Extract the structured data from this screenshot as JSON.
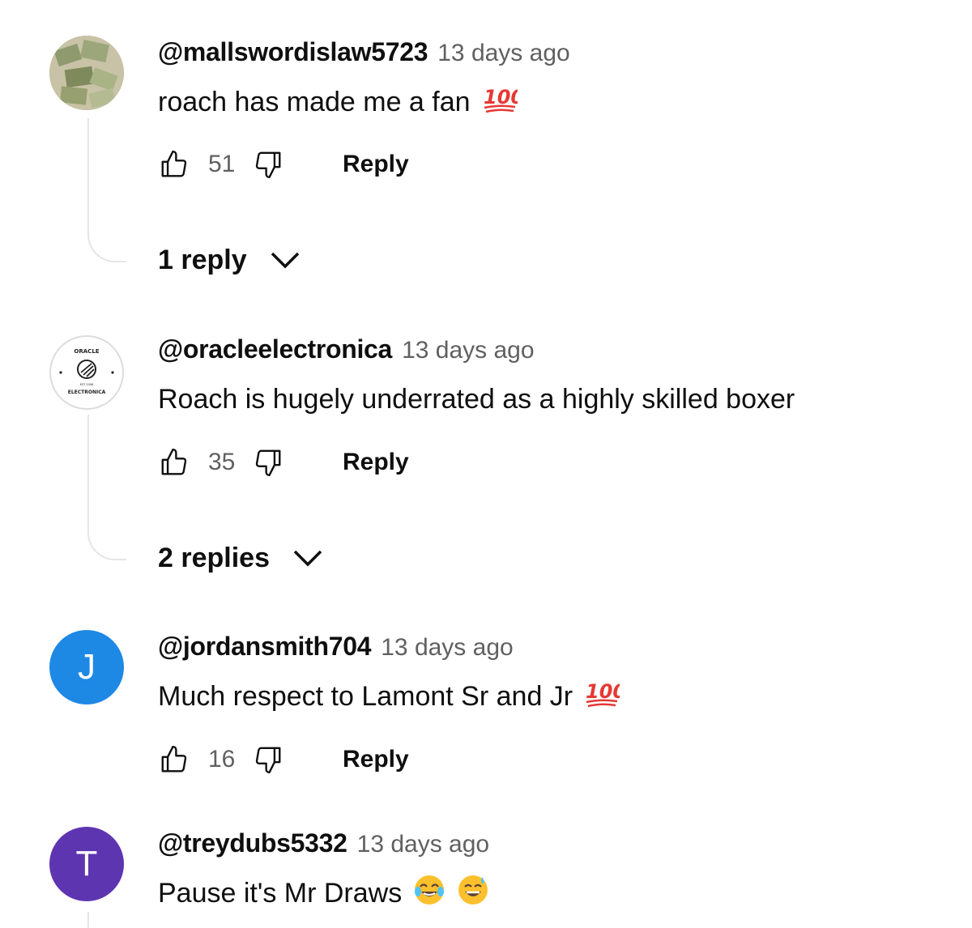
{
  "comments": [
    {
      "author": "@mallswordislaw5723",
      "time": "13 days ago",
      "text": "roach has made me a fan",
      "emojis": [
        "hundred-points-emoji"
      ],
      "likes": "51",
      "reply_label": "Reply",
      "replies_label": "1 reply",
      "avatar_type": "photo"
    },
    {
      "author": "@oracleelectronica",
      "time": "13 days ago",
      "text": "Roach is hugely underrated as a highly skilled boxer",
      "emojis": [],
      "likes": "35",
      "reply_label": "Reply",
      "replies_label": "2 replies",
      "avatar_type": "logo",
      "avatar_logo_text": "ORACLE ELECTRONICA"
    },
    {
      "author": "@jordansmith704",
      "time": "13 days ago",
      "text": "Much respect to Lamont Sr and Jr",
      "emojis": [
        "hundred-points-emoji"
      ],
      "likes": "16",
      "reply_label": "Reply",
      "avatar_type": "letter",
      "avatar_letter": "J",
      "avatar_color": "#1e88e5"
    },
    {
      "author": "@treydubs5332",
      "time": "13 days ago",
      "text": "Pause it's Mr Draws",
      "emojis": [
        "face-with-tears-of-joy-emoji",
        "grinning-face-with-sweat-emoji"
      ],
      "avatar_type": "letter",
      "avatar_letter": "T",
      "avatar_color": "#5e35b1"
    }
  ],
  "colors": {
    "primary_text": "#0f0f0f",
    "secondary_text": "#606060",
    "thread_line": "#e5e5e5"
  }
}
